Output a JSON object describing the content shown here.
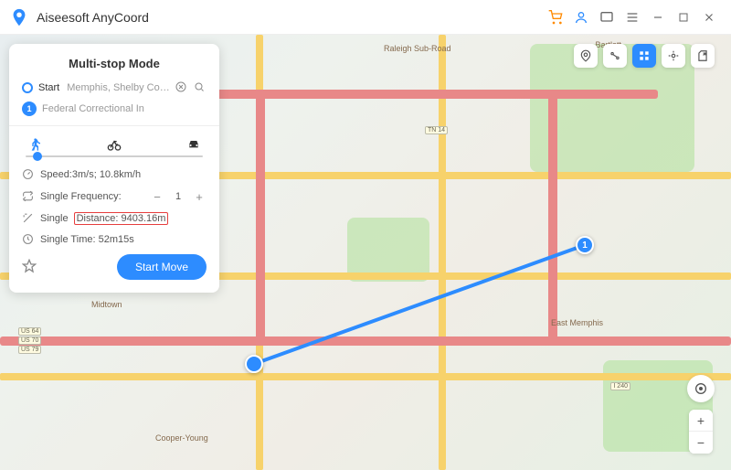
{
  "app": {
    "title": "Aiseesoft AnyCoord"
  },
  "panel": {
    "title": "Multi-stop Mode",
    "start_label": "Start",
    "start_value": "Memphis, Shelby Coun",
    "stop_number": "1",
    "stop_value": "Federal Correctional In",
    "speed": "Speed:3m/s; 10.8km/h",
    "freq_label": "Single Frequency:",
    "freq_value": "1",
    "distance_label": "Single",
    "distance_value": "Distance: 9403.16m",
    "time": "Single Time: 52m15s",
    "start_move": "Start Move"
  },
  "map": {
    "labels": {
      "bartlett": "Bartlett",
      "midtown": "Midtown",
      "eastmemphis": "East Memphis",
      "cooper": "Cooper-Young",
      "raleigh": "Raleigh Sub-Road"
    },
    "shields": {
      "us64": "US 64",
      "us70": "US 70",
      "us79": "US 79",
      "tn14": "TN 14",
      "i240": "I 240"
    }
  }
}
